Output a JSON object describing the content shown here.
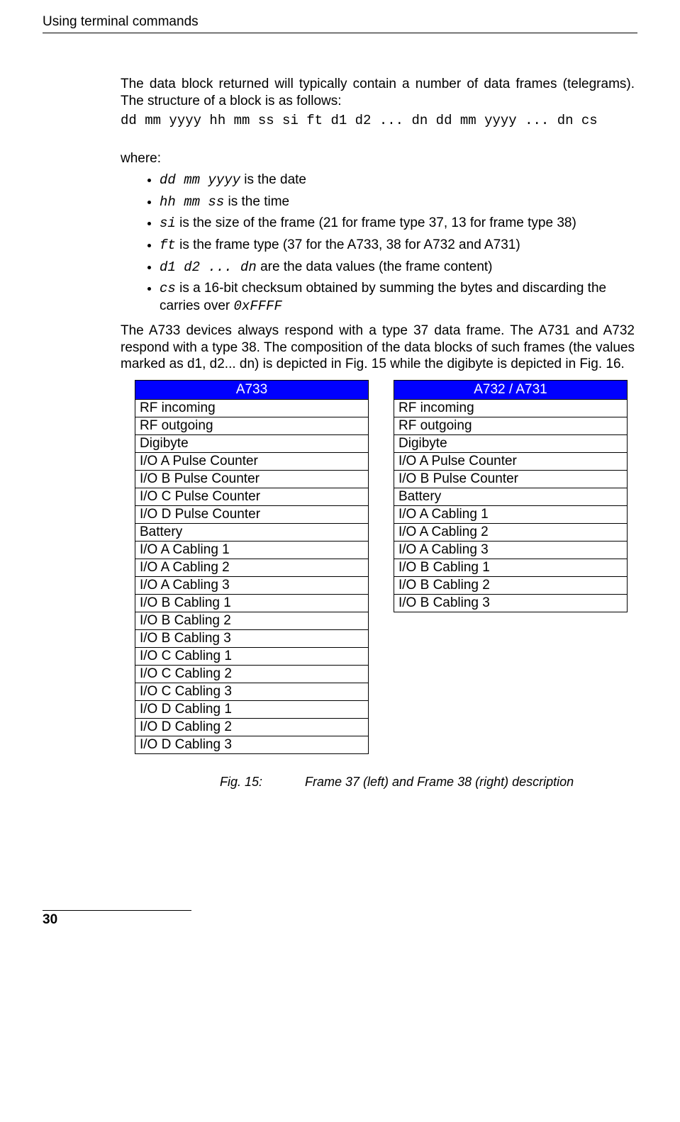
{
  "header": {
    "title": "Using terminal commands"
  },
  "intro": {
    "p1a": "The data block returned will typically contain a number of data frames (telegrams). The structure of a block is as follows:",
    "codeline": "dd mm yyyy hh mm ss si ft d1 d2 ... dn dd mm yyyy ... dn cs",
    "where": "where:"
  },
  "bullets": [
    {
      "code": "dd mm yyyy",
      "after": " is the date"
    },
    {
      "code": "hh mm ss",
      "after": " is the time"
    },
    {
      "code": "si",
      "after": " is the size of the frame (21 for frame type 37, 13 for frame type 38)"
    },
    {
      "code": "ft",
      "after": " is the frame type (37 for the A733, 38 for A732 and A731)"
    },
    {
      "code": "d1 d2 ... dn",
      "after": " are the data values (the frame content)"
    },
    {
      "code": "cs",
      "after": " is a 16-bit checksum obtained by summing the bytes and discarding the carries over ",
      "trailcode": "0xFFFF"
    }
  ],
  "after_para": "The A733 devices always respond with a type 37 data frame. The A731 and A732 respond with a type 38. The composition of the data blocks of such frames (the values marked as d1, d2... dn) is depicted in Fig. 15 while the digibyte is depicted in Fig. 16.",
  "tableA": {
    "header": "A733",
    "rows": [
      "RF incoming",
      "RF outgoing",
      "Digibyte",
      "I/O A Pulse Counter",
      "I/O B Pulse Counter",
      "I/O C Pulse Counter",
      "I/O D Pulse Counter",
      "Battery",
      "I/O A Cabling 1",
      "I/O A Cabling 2",
      "I/O A Cabling 3",
      "I/O B Cabling 1",
      "I/O B Cabling 2",
      "I/O B Cabling 3",
      "I/O C Cabling 1",
      "I/O C Cabling 2",
      "I/O C Cabling 3",
      "I/O D Cabling 1",
      "I/O D Cabling 2",
      "I/O D Cabling 3"
    ]
  },
  "tableB": {
    "header": "A732 / A731",
    "rows": [
      "RF incoming",
      "RF outgoing",
      "Digibyte",
      "I/O A Pulse Counter",
      "I/O B Pulse Counter",
      "Battery",
      "I/O A Cabling 1",
      "I/O A Cabling 2",
      "I/O A Cabling 3",
      "I/O B Cabling 1",
      "I/O B Cabling 2",
      "I/O B Cabling 3"
    ]
  },
  "caption": {
    "label": "Fig. 15:",
    "text": "Frame 37 (left) and Frame 38 (right) description"
  },
  "footer": {
    "page": "30"
  }
}
